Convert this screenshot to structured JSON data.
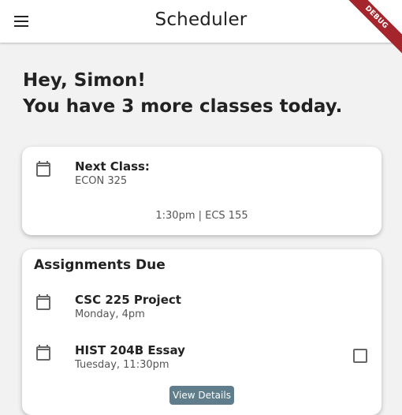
{
  "app": {
    "title": "Scheduler",
    "debug_label": "DEBUG"
  },
  "greeting": {
    "line1": "Hey, Simon!",
    "line2": "You have 3 more classes today."
  },
  "next_class": {
    "title": "Next Class:",
    "course": "ECON 325",
    "detail": "1:30pm | ECS 155",
    "icon": "calendar-icon"
  },
  "assignments": {
    "title": "Assignments Due",
    "items": [
      {
        "title": "CSC 225 Project",
        "due": "Monday, 4pm",
        "icon": "calendar-icon"
      },
      {
        "title": "HIST 204B Essay",
        "due": "Tuesday, 11:30pm",
        "icon": "calendar-icon",
        "checked": false
      }
    ],
    "button_label": "View Details"
  },
  "colors": {
    "background": "#f2f2f2",
    "card": "#ffffff",
    "button": "#607d8b",
    "debug_ribbon": "#a4262c"
  }
}
